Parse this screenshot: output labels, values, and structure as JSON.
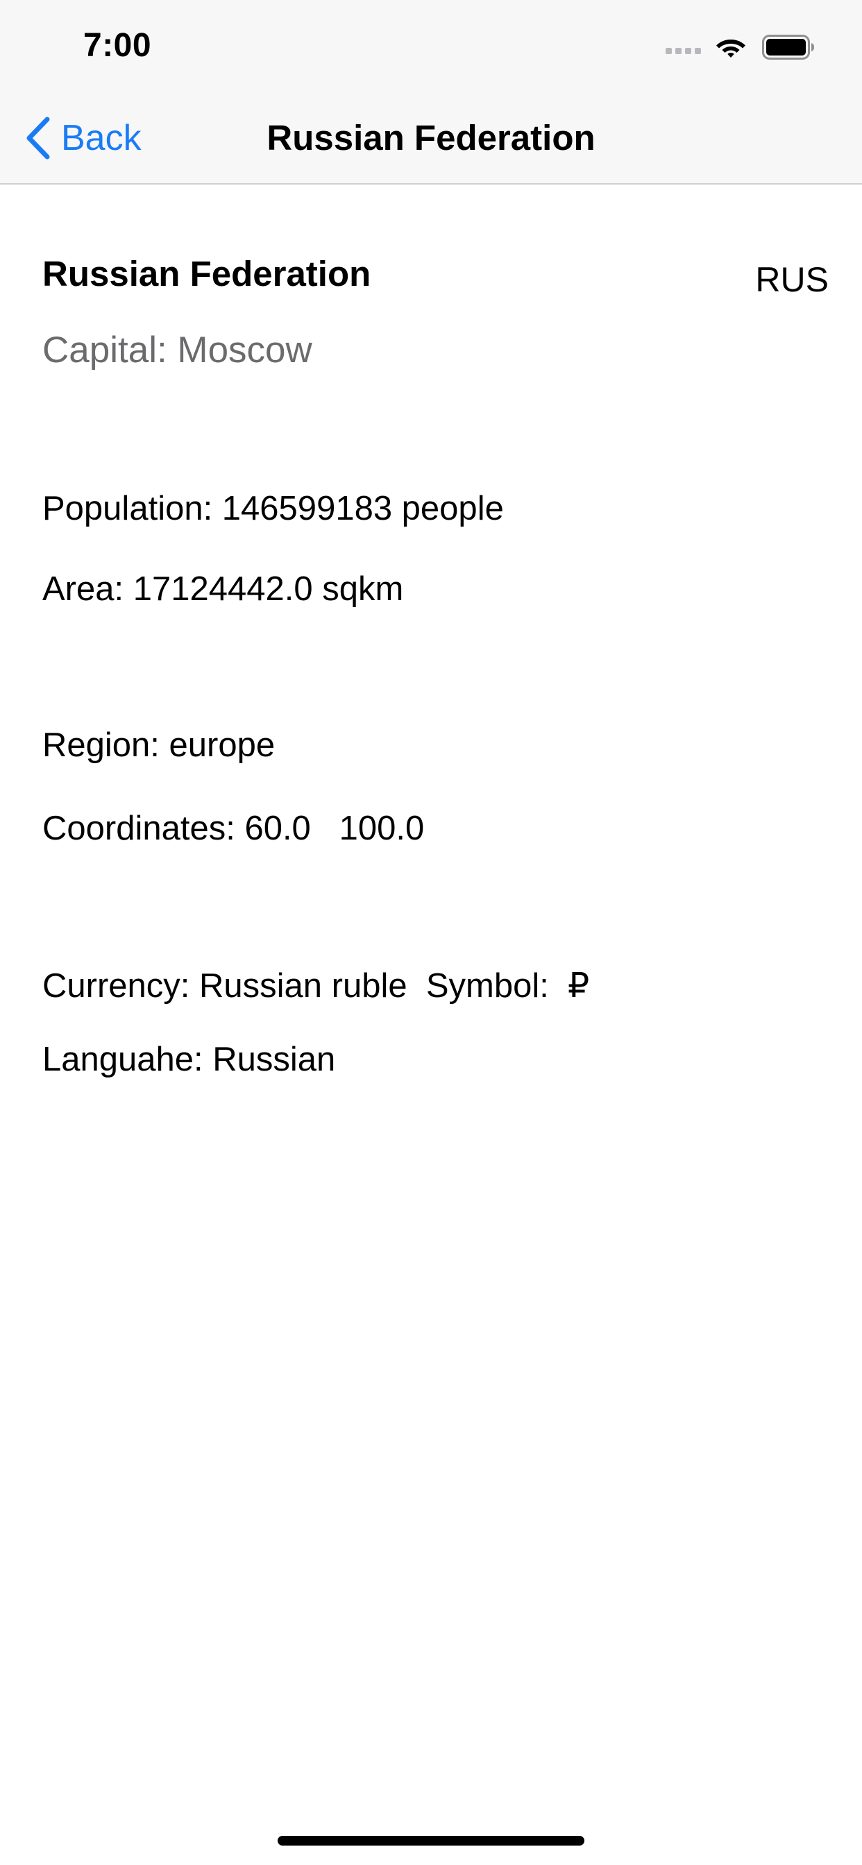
{
  "status_bar": {
    "time": "7:00",
    "icons": [
      "signal-dots-icon",
      "wifi-icon",
      "battery-icon"
    ]
  },
  "nav": {
    "back_label": "Back",
    "title": "Russian Federation",
    "accent_color": "#1a7cf5"
  },
  "country": {
    "name": "Russian Federation",
    "code": "RUS",
    "capital": "Capital: Moscow",
    "population": "Population: 146599183 people",
    "area": "Area: 17124442.0 sqkm",
    "region": "Region: europe",
    "coordinates": "Coordinates: 60.0   100.0",
    "currency": "Currency: Russian ruble  Symbol:  ₽",
    "language": "Languahe: Russian"
  }
}
